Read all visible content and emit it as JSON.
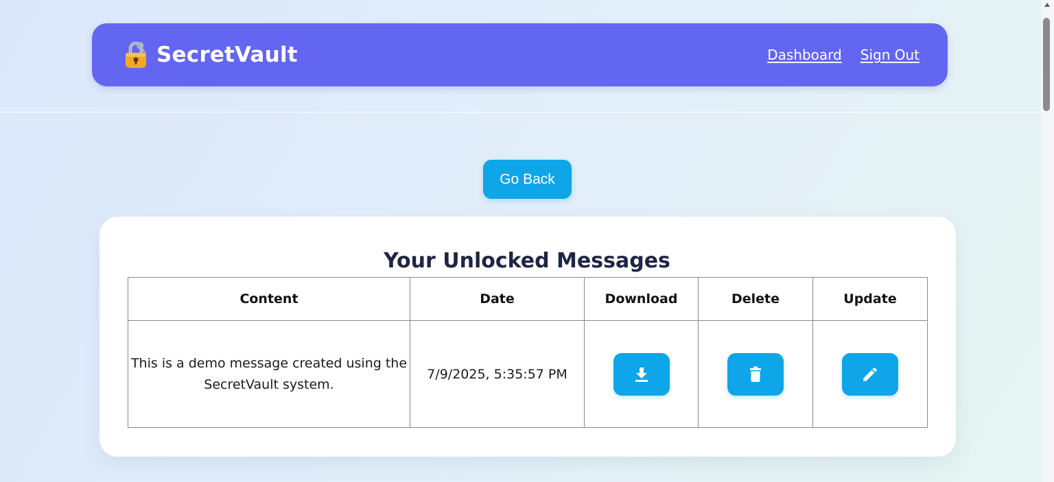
{
  "header": {
    "brand": "SecretVault",
    "brand_icon": "lock-icon",
    "nav": {
      "dashboard": "Dashboard",
      "sign_out": "Sign Out"
    }
  },
  "go_back_label": "Go Back",
  "messages": {
    "title": "Your Unlocked Messages",
    "columns": [
      "Content",
      "Date",
      "Download",
      "Delete",
      "Update"
    ],
    "rows": [
      {
        "content": "This is a demo message created using the SecretVault system.",
        "date": "7/9/2025, 5:35:57 PM",
        "download_icon": "download-icon",
        "delete_icon": "trash-icon",
        "update_icon": "pencil-icon"
      }
    ]
  },
  "colors": {
    "nav_bg": "#6366f1",
    "accent": "#0ea5e9",
    "card_bg": "#ffffff",
    "page_bg_start": "#dbe8fb",
    "page_bg_end": "#e6f5f1"
  }
}
